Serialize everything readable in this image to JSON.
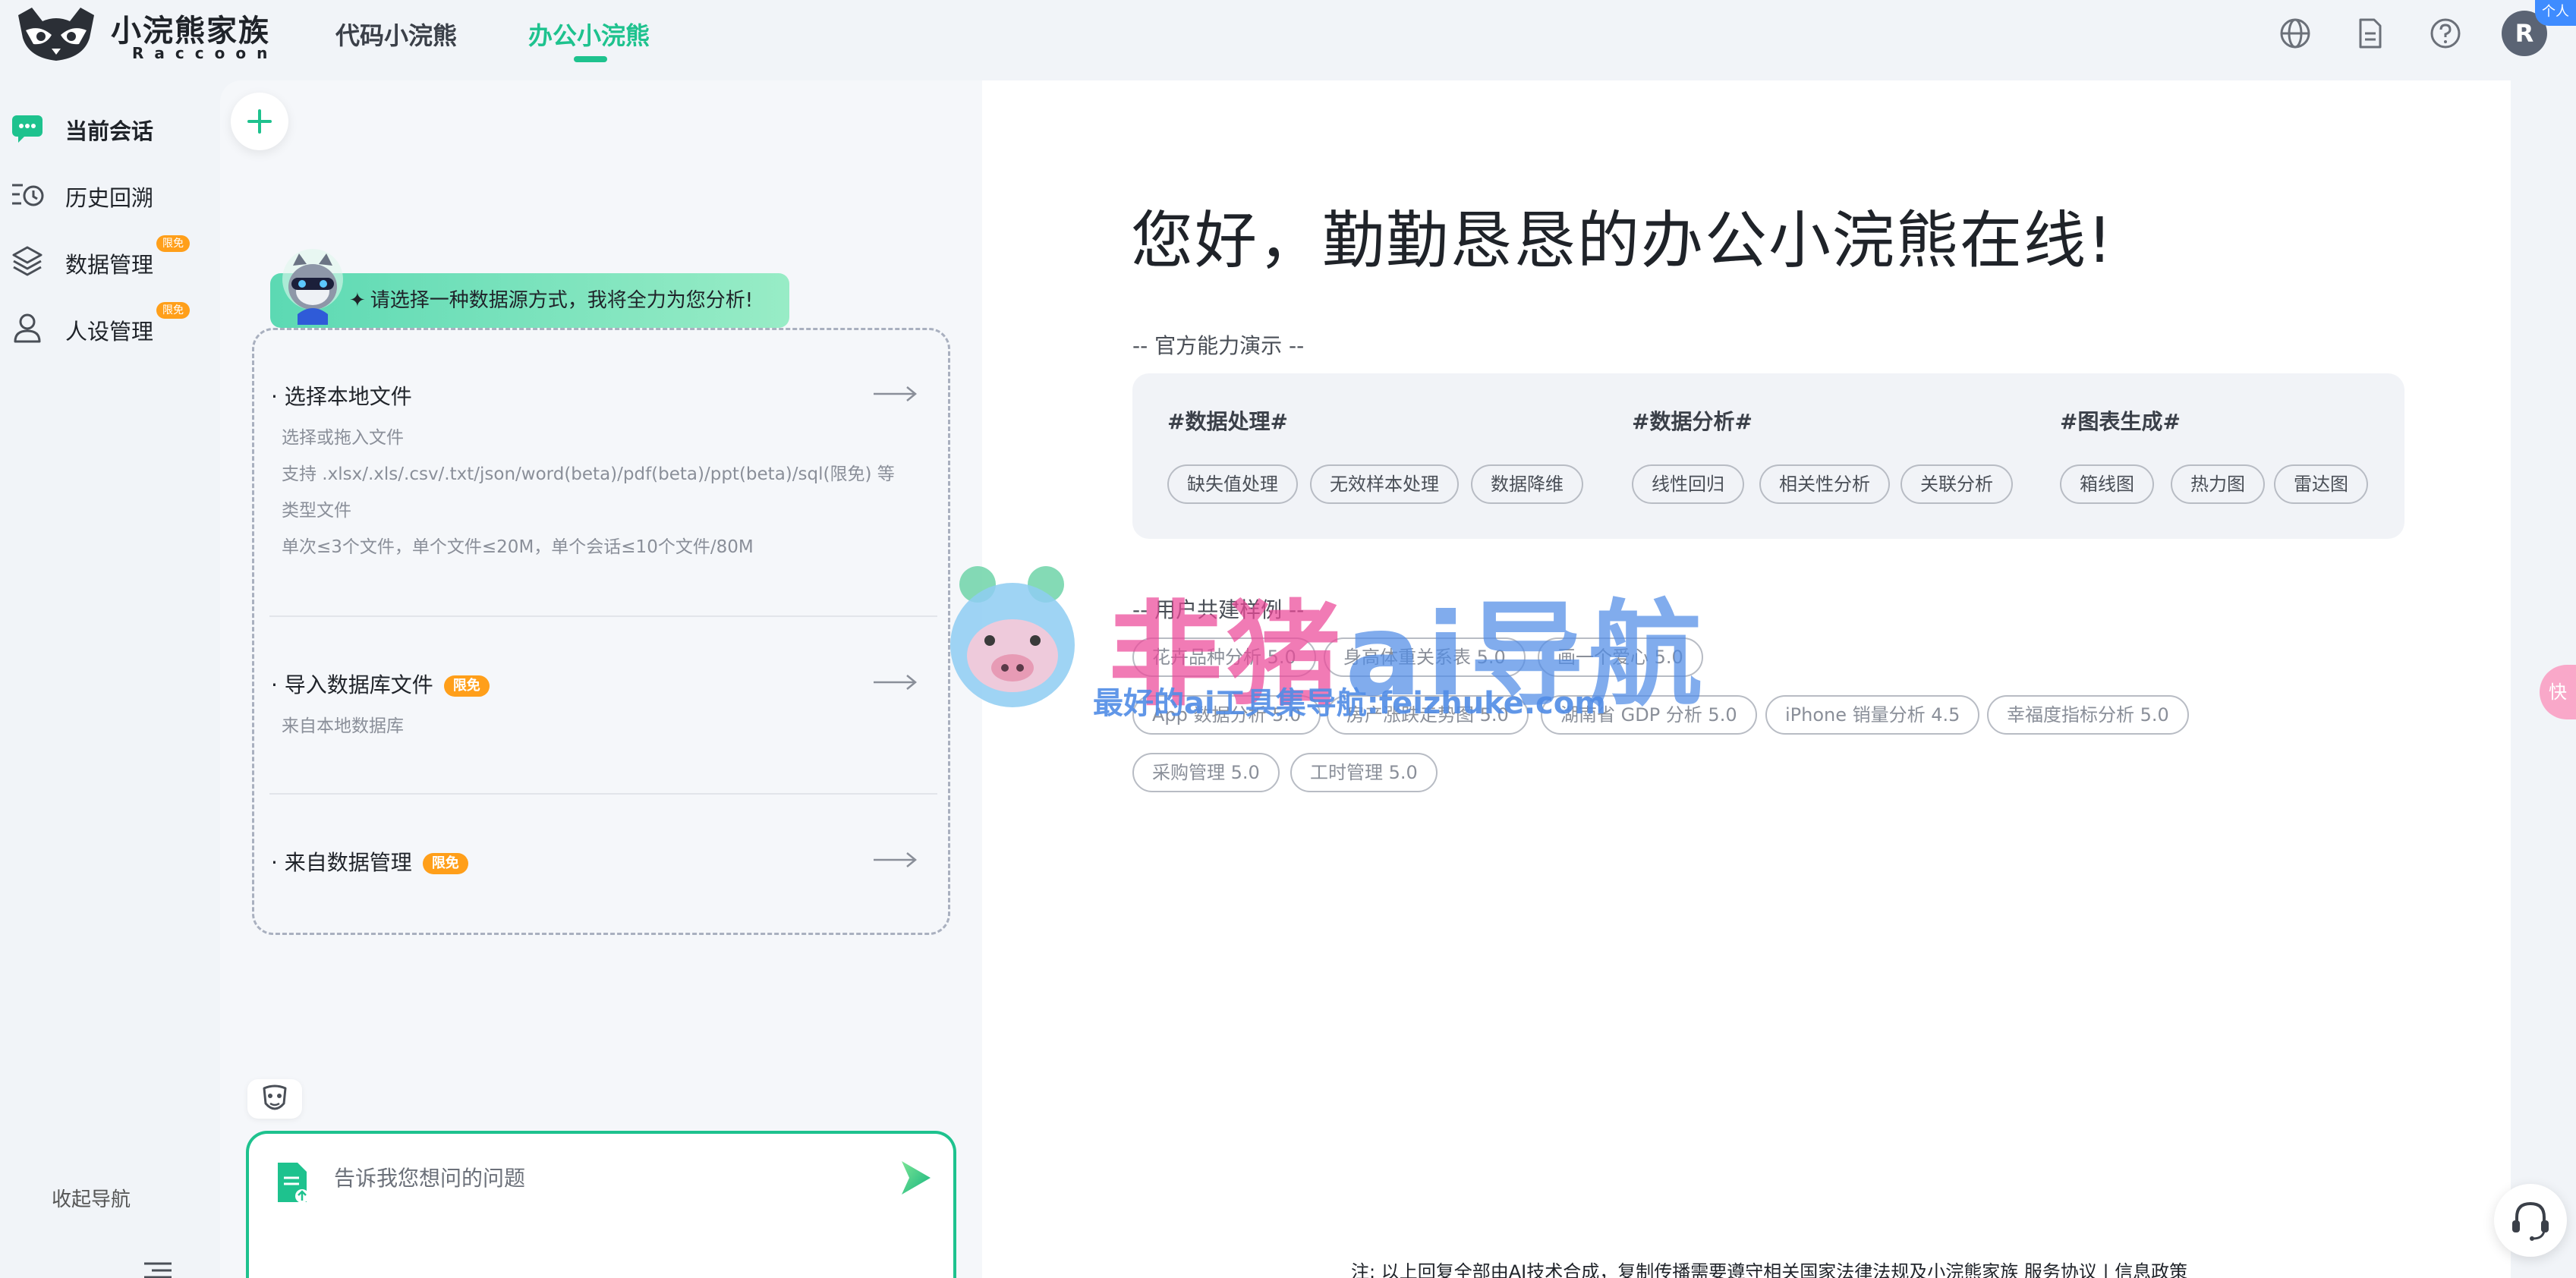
{
  "colors": {
    "brand_green": "#1ec28e",
    "badge_orange": "#ff9f1a",
    "corner_blue": "#3f8cff"
  },
  "header": {
    "logo_name": "小浣熊家族",
    "logo_sub": "Raccoon",
    "tabs": [
      {
        "label": "代码小浣熊",
        "active": false
      },
      {
        "label": "办公小浣熊",
        "active": true
      }
    ],
    "icons": [
      "globe-icon",
      "document-icon",
      "help-icon"
    ],
    "avatar_letter": "R",
    "corner_badge": "个人"
  },
  "sidebar": {
    "items": [
      {
        "label": "当前会话",
        "icon": "chat-icon",
        "active": true,
        "badge": ""
      },
      {
        "label": "历史回溯",
        "icon": "history-icon",
        "active": false,
        "badge": ""
      },
      {
        "label": "数据管理",
        "icon": "layers-icon",
        "active": false,
        "badge": "限免"
      },
      {
        "label": "人设管理",
        "icon": "user-icon",
        "active": false,
        "badge": "限免"
      }
    ],
    "collapse_label": "收起导航"
  },
  "chat": {
    "greeting": "请选择一种数据源方式，我将全力为您分析!",
    "sources": [
      {
        "title": "· 选择本地文件",
        "badge": "",
        "desc": [
          "选择或拖入文件",
          "支持 .xlsx/.xls/.csv/.txt/json/word(beta)/pdf(beta)/ppt(beta)/sql(限免) 等",
          "类型文件",
          "单次≤3个文件，单个文件≤20M，单个会话≤10个文件/80M"
        ]
      },
      {
        "title": "· 导入数据库文件",
        "badge": "限免",
        "desc": [
          "来自本地数据库"
        ]
      },
      {
        "title": "· 来自数据管理",
        "badge": "限免",
        "desc": []
      }
    ],
    "input_placeholder": "告诉我您想问的问题"
  },
  "welcome": {
    "title": "您好，勤勤恳恳的办公小浣熊在线!",
    "demo_label": "-- 官方能力演示 --",
    "demo_groups": [
      {
        "title": "#数据处理#",
        "chips": [
          "缺失值处理",
          "无效样本处理",
          "数据降维"
        ]
      },
      {
        "title": "#数据分析#",
        "chips": [
          "线性回归",
          "相关性分析",
          "关联分析"
        ]
      },
      {
        "title": "#图表生成#",
        "chips": [
          "箱线图",
          "热力图",
          "雷达图"
        ]
      }
    ],
    "cases_label": "-- 用户共建样例 --",
    "cases": [
      "花卉品种分析 5.0",
      "身高体重关系表 5.0",
      "画一个爱心 5.0",
      "App 数据分析 5.0",
      "房产涨跌走势图 5.0",
      "湖南省 GDP 分析 5.0",
      "iPhone 销量分析 4.5",
      "幸福度指标分析 5.0",
      "采购管理 5.0",
      "工时管理 5.0"
    ]
  },
  "watermark": {
    "main_pink": "非猪",
    "main_blue": "ai导航",
    "sub": "最好的ai工具集导航:feizhuke.com"
  },
  "side_tab": "快",
  "footer": {
    "text": "注: 以上回复全部由AI技术合成，复制传播需要遵守相关国家法律法规及小浣熊家族 ",
    "link1": "服务协议",
    "sep": " | ",
    "link2": "信息政策"
  }
}
